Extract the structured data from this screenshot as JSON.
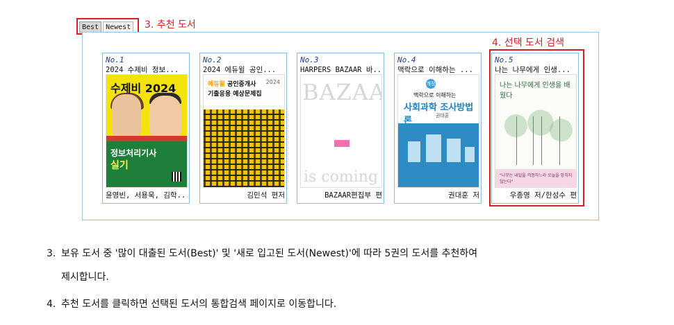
{
  "tabs": {
    "best_label": "Best",
    "newest_label": "Newest",
    "active": "Best"
  },
  "callouts": {
    "recommended": "3. 추천 도서",
    "selection_search": "4. 선택 도서 검색"
  },
  "books": [
    {
      "number": "No.1",
      "title": "2024 수제비 정보...",
      "author": "윤영빈, 서용욱, 김학...",
      "cover": {
        "heading": "수제비 2024",
        "line1": "정보처리기사",
        "line2": "실기"
      }
    },
    {
      "number": "No.2",
      "title": "2024 에듀윌 공인...",
      "author": "김민석 편저",
      "cover": {
        "label_highlight": "에듀윌",
        "label_rest": " 공인중개사",
        "sub": "기출응용 예상문제집",
        "year": "2024"
      }
    },
    {
      "number": "No.3",
      "title": "HARPERS BAZAAR 바...",
      "author": "BAZAAR편집부 편",
      "cover": {
        "brand": "BAZAAR",
        "tagline": "is coming"
      }
    },
    {
      "number": "No.4",
      "title": "맥락으로 이해하는 ...",
      "author": "권대훈 저",
      "cover": {
        "edition": "개정3판",
        "line1": "맥락으로 이해하는",
        "line2": "사회과학 조사방법론",
        "author_small": "권대훈"
      }
    },
    {
      "number": "No.5",
      "title": "나는 나무에게 인생...",
      "author": "우종영 저/한성수 편",
      "cover": {
        "heading": "나는 나무에게 인생을 배웠다",
        "quote": "\"나무는 내일을 걱정하느라 오늘을 망치지 않는다\""
      }
    }
  ],
  "instructions": {
    "item3_num": "3.",
    "item3_text": "보유 도서 중 '많이 대출된 도서(Best)' 및 '새로 입고된 도서(Newest)'에 따라 5권의 도서를 추천하여",
    "item3_cont": "제시합니다.",
    "item4_num": "4.",
    "item4_text": "추천 도서를 클릭하면 선택된 도서의 통합검색 페이지로 이동합니다."
  }
}
